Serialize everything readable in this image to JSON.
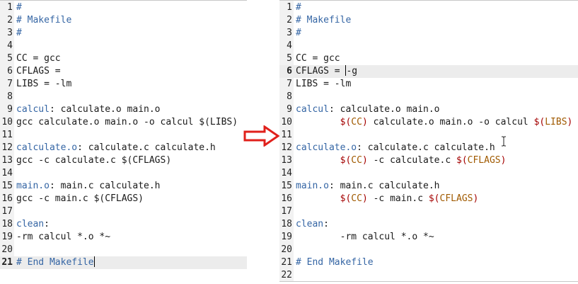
{
  "left_pane": {
    "lines": [
      {
        "n": "1",
        "segs": [
          {
            "t": "#",
            "k": "c"
          }
        ]
      },
      {
        "n": "2",
        "segs": [
          {
            "t": "# Makefile",
            "k": "c"
          }
        ]
      },
      {
        "n": "3",
        "segs": [
          {
            "t": "#",
            "k": "c"
          }
        ]
      },
      {
        "n": "4",
        "segs": []
      },
      {
        "n": "5",
        "segs": [
          {
            "t": "CC = gcc",
            "k": ""
          }
        ]
      },
      {
        "n": "6",
        "segs": [
          {
            "t": "CFLAGS =",
            "k": ""
          }
        ]
      },
      {
        "n": "7",
        "segs": [
          {
            "t": "LIBS = -lm",
            "k": ""
          }
        ]
      },
      {
        "n": "8",
        "segs": []
      },
      {
        "n": "9",
        "segs": [
          {
            "t": "calcul",
            "k": "t"
          },
          {
            "t": ": calculate.o main.o",
            "k": ""
          }
        ]
      },
      {
        "n": "10",
        "segs": [
          {
            "t": "gcc calculate.o main.o -o calcul $(LIBS)",
            "k": ""
          }
        ]
      },
      {
        "n": "11",
        "segs": []
      },
      {
        "n": "12",
        "segs": [
          {
            "t": "calculate.o",
            "k": "t"
          },
          {
            "t": ": calculate.c calculate.h",
            "k": ""
          }
        ]
      },
      {
        "n": "13",
        "segs": [
          {
            "t": "gcc -c calculate.c $(CFLAGS)",
            "k": ""
          }
        ]
      },
      {
        "n": "14",
        "segs": []
      },
      {
        "n": "15",
        "segs": [
          {
            "t": "main.o",
            "k": "t"
          },
          {
            "t": ": main.c calculate.h",
            "k": ""
          }
        ]
      },
      {
        "n": "16",
        "segs": [
          {
            "t": "gcc -c main.c $(CFLAGS)",
            "k": ""
          }
        ]
      },
      {
        "n": "17",
        "segs": []
      },
      {
        "n": "18",
        "segs": [
          {
            "t": "clean",
            "k": "t"
          },
          {
            "t": ":",
            "k": ""
          }
        ]
      },
      {
        "n": "19",
        "segs": [
          {
            "t": "-rm calcul *.o *~",
            "k": ""
          }
        ]
      },
      {
        "n": "20",
        "segs": []
      },
      {
        "n": "21",
        "segs": [
          {
            "t": "# End Makefile",
            "k": "c"
          },
          {
            "caret": true
          }
        ],
        "current": true
      }
    ]
  },
  "right_pane": {
    "lines": [
      {
        "n": "1",
        "segs": [
          {
            "t": "#",
            "k": "c"
          }
        ]
      },
      {
        "n": "2",
        "segs": [
          {
            "t": "# Makefile",
            "k": "c"
          }
        ]
      },
      {
        "n": "3",
        "segs": [
          {
            "t": "#",
            "k": "c"
          }
        ]
      },
      {
        "n": "4",
        "segs": []
      },
      {
        "n": "5",
        "segs": [
          {
            "t": "CC = gcc",
            "k": ""
          }
        ]
      },
      {
        "n": "6",
        "segs": [
          {
            "t": "CFLAGS = ",
            "k": ""
          },
          {
            "caret": true
          },
          {
            "t": "-g",
            "k": ""
          }
        ],
        "current": true
      },
      {
        "n": "7",
        "segs": [
          {
            "t": "LIBS = -lm",
            "k": ""
          }
        ]
      },
      {
        "n": "8",
        "segs": []
      },
      {
        "n": "9",
        "segs": [
          {
            "t": "calcul",
            "k": "t"
          },
          {
            "t": ": calculate.o main.o",
            "k": ""
          }
        ]
      },
      {
        "n": "10",
        "segs": [
          {
            "t": "        ",
            "k": ""
          },
          {
            "t": "$(",
            "k": "v"
          },
          {
            "t": "CC",
            "k": "vn"
          },
          {
            "t": ")",
            "k": "v"
          },
          {
            "t": " calculate.o main.o -o calcul ",
            "k": ""
          },
          {
            "t": "$(",
            "k": "v"
          },
          {
            "t": "LIBS",
            "k": "vn"
          },
          {
            "t": ")",
            "k": "v"
          }
        ]
      },
      {
        "n": "11",
        "segs": []
      },
      {
        "n": "12",
        "segs": [
          {
            "t": "calculate.o",
            "k": "t"
          },
          {
            "t": ": calculate.c calculate.h",
            "k": ""
          }
        ]
      },
      {
        "n": "13",
        "segs": [
          {
            "t": "        ",
            "k": ""
          },
          {
            "t": "$(",
            "k": "v"
          },
          {
            "t": "CC",
            "k": "vn"
          },
          {
            "t": ")",
            "k": "v"
          },
          {
            "t": " -c calculate.c ",
            "k": ""
          },
          {
            "t": "$(",
            "k": "v"
          },
          {
            "t": "CFLAGS",
            "k": "vn"
          },
          {
            "t": ")",
            "k": "v"
          }
        ]
      },
      {
        "n": "14",
        "segs": []
      },
      {
        "n": "15",
        "segs": [
          {
            "t": "main.o",
            "k": "t"
          },
          {
            "t": ": main.c calculate.h",
            "k": ""
          }
        ]
      },
      {
        "n": "16",
        "segs": [
          {
            "t": "        ",
            "k": ""
          },
          {
            "t": "$(",
            "k": "v"
          },
          {
            "t": "CC",
            "k": "vn"
          },
          {
            "t": ")",
            "k": "v"
          },
          {
            "t": " -c main.c ",
            "k": ""
          },
          {
            "t": "$(",
            "k": "v"
          },
          {
            "t": "CFLAGS",
            "k": "vn"
          },
          {
            "t": ")",
            "k": "v"
          }
        ]
      },
      {
        "n": "17",
        "segs": []
      },
      {
        "n": "18",
        "segs": [
          {
            "t": "clean",
            "k": "t"
          },
          {
            "t": ":",
            "k": ""
          }
        ]
      },
      {
        "n": "19",
        "segs": [
          {
            "t": "        -rm calcul *.o *~",
            "k": ""
          }
        ]
      },
      {
        "n": "20",
        "segs": []
      },
      {
        "n": "21",
        "segs": [
          {
            "t": "# End Makefile",
            "k": "c"
          }
        ]
      },
      {
        "n": "22",
        "segs": []
      }
    ]
  },
  "icons": {
    "arrow": "right-arrow-icon",
    "mouse_cursor": "text-cursor-icon"
  },
  "colors": {
    "comment": "#3465a4",
    "target": "#3465a4",
    "variable_delim": "#a40000",
    "variable_name": "#a05a00",
    "arrow": "#e0201b",
    "gutter": "#f2f2f2",
    "current_line": "#ececec"
  }
}
